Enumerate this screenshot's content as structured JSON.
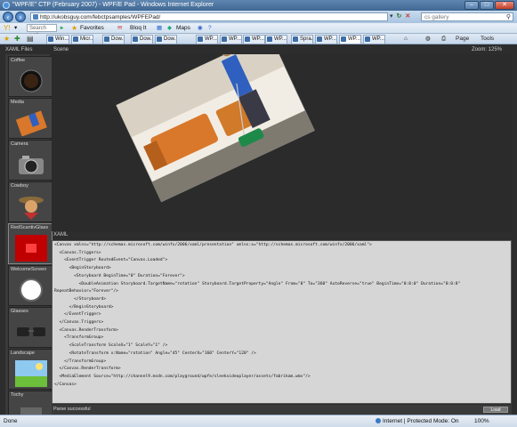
{
  "window": {
    "title": "\"WPF/E\" CTP (February 2007) - WPF/E Pad - Windows Internet Explorer",
    "buttons": [
      "–",
      "□",
      "✕"
    ]
  },
  "address": {
    "url": "http://ukobsguy.com/febctpsamples/WPFEPad/",
    "search_value": "cs gallery"
  },
  "linkbar": {
    "search_placeholder": "Search web",
    "favorites": "Favorites",
    "bloq": "Bloq It",
    "maps": "Maps"
  },
  "tabs": [
    "Win...",
    "Micr...",
    "Dow...",
    "Dow...",
    "Dow...",
    "WP...",
    "WP...",
    "WP...",
    "WP...",
    "Spra...",
    "WP...",
    "WP...",
    "WP..."
  ],
  "toolbar_right": {
    "page": "Page",
    "tools": "Tools"
  },
  "app": {
    "files_header": "XAML Files",
    "scene_header": "Scene",
    "zoom": "Zoom: 125%",
    "xaml_header": "XAML",
    "status": "Parse successful",
    "load_button": "Load",
    "thumbs": [
      "Coffee",
      "Media",
      "Camera",
      "Cowboy",
      "RedScantivGlass",
      "WelcomeScreen",
      "Glasses",
      "Landscape",
      "Tochy"
    ],
    "code": "<Canvas xmlns=\"http://schemas.microsoft.com/winfx/2006/xaml/presentation\" xmlns:x=\"http://schemas.microsoft.com/winfx/2006/xaml\">\n  <Canvas.Triggers>\n    <EventTrigger RoutedEvent=\"Canvas.Loaded\">\n      <BeginStoryboard>\n        <Storyboard BeginTime=\"0\" Duration=\"Forever\">\n          <DoubleAnimation Storyboard.TargetName=\"rotation\" Storyboard.TargetProperty=\"Angle\" From=\"0\" To=\"360\" AutoReverse=\"true\" BeginTime=\"0:0:0\" Duration=\"0:0:8\"\nRepeatBehavior=\"Forever\"/>\n        </Storyboard>\n      </BeginStoryboard>\n    </EventTrigger>\n  </Canvas.Triggers>\n  <Canvas.RenderTransform>\n    <TransformGroup>\n      <ScaleTransform ScaleX=\"1\" ScaleY=\"1\" />\n      <RotateTransform x:Name=\"rotation\" Angle=\"45\" CenterX=\"160\" CenterY=\"120\" />\n    </TransformGroup>\n  </Canvas.RenderTransform>\n  <MediaElement Source=\"http://channel9.msdn.com/playground/wpfe/sleekvideoplayer/assets/fabrikam.wmv\"/>\n</Canvas>"
  },
  "statusbar": {
    "left": "Done",
    "zone": "Internet | Protected Mode: On",
    "zoom": "100%"
  }
}
